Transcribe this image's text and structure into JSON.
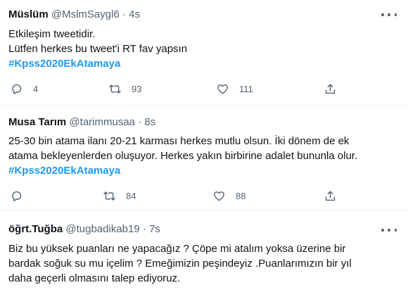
{
  "tweets": [
    {
      "name": "Müslüm",
      "handle": "@MslmSaygl6",
      "dot": "·",
      "time": "4s",
      "lines": [
        "Etkileşim tweetidir.",
        "Lütfen herkes bu tweet'i RT fav yapsın"
      ],
      "hashtag": "#Kpss2020EkAtamaya",
      "replies": "4",
      "retweets": "93",
      "likes": "111"
    },
    {
      "name": "Musa Tarım",
      "handle": "@tarimmusaa",
      "dot": "·",
      "time": "8s",
      "lines": [
        "25-30 bin atama ilanı 20-21 karması herkes mutlu olsun. İki dönem de ek",
        "atama bekleyenlerden oluşuyor. Herkes yakın birbirine adalet bununla olur."
      ],
      "hashtag": "#Kpss2020EkAtamaya",
      "replies": "",
      "retweets": "84",
      "likes": "88"
    },
    {
      "name": "öğrt.Tuğba",
      "handle": "@tugbadikab19",
      "dot": "·",
      "time": "7s",
      "lines": [
        "Biz bu yüksek puanları ne yapacağız ? Çöpe mi atalım yoksa üzerine  bir",
        "bardak soğuk su mu içelim ? Emeğimizin peşindeyiz .Puanlarımızın bir yıl",
        "daha geçerli olmasını talep ediyoruz."
      ]
    }
  ],
  "icons": {
    "reply": "reply-icon",
    "retweet": "retweet-icon",
    "like": "heart-icon",
    "share": "share-icon",
    "more": "more-icon"
  },
  "colors": {
    "text": "#0f1419",
    "secondary": "#536471",
    "hashtag": "#1d9bf0",
    "divider": "#eff3f4"
  }
}
